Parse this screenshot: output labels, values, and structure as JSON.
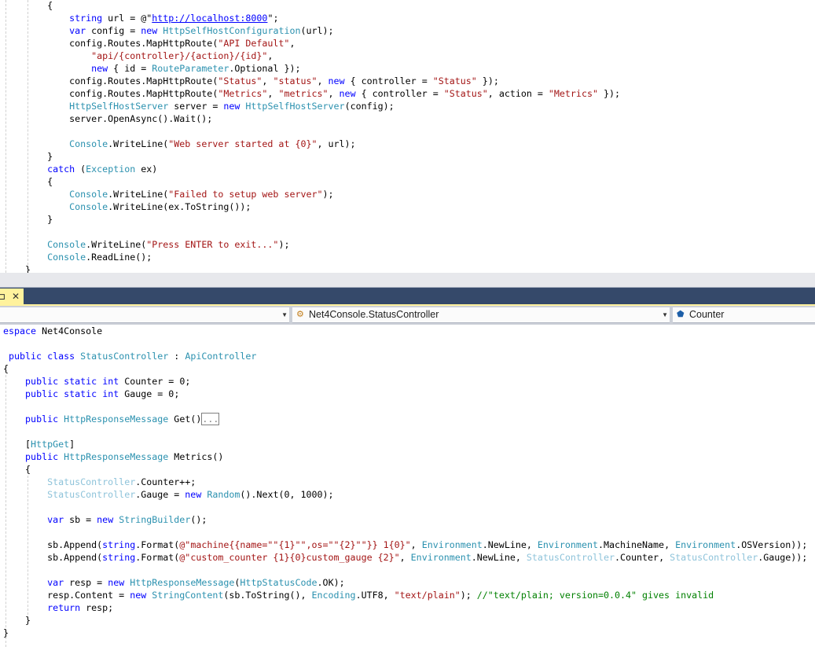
{
  "colors": {
    "keyword": "#0000ff",
    "type": "#2b91af",
    "string": "#a31515",
    "comment": "#008000",
    "titlebar": "#35496a",
    "tab": "#fff29d"
  },
  "tab": {
    "pin_icon": "⊐",
    "close_icon": "✕"
  },
  "navbar": {
    "project_dropdown": {
      "label": ""
    },
    "class_dropdown": {
      "label": "Net4Console.StatusController",
      "icon": "class-icon"
    },
    "member_dropdown": {
      "label": "Counter",
      "icon": "field-icon"
    }
  },
  "top_code": {
    "lines": [
      [
        [
          "p",
          "        {"
        ]
      ],
      [
        [
          "p",
          "            "
        ],
        [
          "k",
          "string"
        ],
        [
          "p",
          " url = @\""
        ],
        [
          "u",
          "http://localhost:8000"
        ],
        [
          "p",
          "\";"
        ]
      ],
      [
        [
          "p",
          "            "
        ],
        [
          "k",
          "var"
        ],
        [
          "p",
          " config = "
        ],
        [
          "k",
          "new"
        ],
        [
          "p",
          " "
        ],
        [
          "t",
          "HttpSelfHostConfiguration"
        ],
        [
          "p",
          "(url);"
        ]
      ],
      [
        [
          "p",
          "            config.Routes.MapHttpRoute("
        ],
        [
          "s",
          "\"API Default\""
        ],
        [
          "p",
          ","
        ]
      ],
      [
        [
          "p",
          "                "
        ],
        [
          "s",
          "\"api/{controller}/{action}/{id}\""
        ],
        [
          "p",
          ","
        ]
      ],
      [
        [
          "p",
          "                "
        ],
        [
          "k",
          "new"
        ],
        [
          "p",
          " { id = "
        ],
        [
          "t",
          "RouteParameter"
        ],
        [
          "p",
          ".Optional });"
        ]
      ],
      [
        [
          "p",
          "            config.Routes.MapHttpRoute("
        ],
        [
          "s",
          "\"Status\""
        ],
        [
          "p",
          ", "
        ],
        [
          "s",
          "\"status\""
        ],
        [
          "p",
          ", "
        ],
        [
          "k",
          "new"
        ],
        [
          "p",
          " { controller = "
        ],
        [
          "s",
          "\"Status\""
        ],
        [
          "p",
          " });"
        ]
      ],
      [
        [
          "p",
          "            config.Routes.MapHttpRoute("
        ],
        [
          "s",
          "\"Metrics\""
        ],
        [
          "p",
          ", "
        ],
        [
          "s",
          "\"metrics\""
        ],
        [
          "p",
          ", "
        ],
        [
          "k",
          "new"
        ],
        [
          "p",
          " { controller = "
        ],
        [
          "s",
          "\"Status\""
        ],
        [
          "p",
          ", action = "
        ],
        [
          "s",
          "\"Metrics\""
        ],
        [
          "p",
          " });"
        ]
      ],
      [
        [
          "p",
          "            "
        ],
        [
          "t",
          "HttpSelfHostServer"
        ],
        [
          "p",
          " server = "
        ],
        [
          "k",
          "new"
        ],
        [
          "p",
          " "
        ],
        [
          "t",
          "HttpSelfHostServer"
        ],
        [
          "p",
          "(config);"
        ]
      ],
      [
        [
          "p",
          "            server.OpenAsync().Wait();"
        ]
      ],
      [
        [
          "p",
          ""
        ]
      ],
      [
        [
          "p",
          "            "
        ],
        [
          "t",
          "Console"
        ],
        [
          "p",
          ".WriteLine("
        ],
        [
          "s",
          "\"Web server started at {0}\""
        ],
        [
          "p",
          ", url);"
        ]
      ],
      [
        [
          "p",
          "        }"
        ]
      ],
      [
        [
          "p",
          "        "
        ],
        [
          "k",
          "catch"
        ],
        [
          "p",
          " ("
        ],
        [
          "t",
          "Exception"
        ],
        [
          "p",
          " ex)"
        ]
      ],
      [
        [
          "p",
          "        {"
        ]
      ],
      [
        [
          "p",
          "            "
        ],
        [
          "t",
          "Console"
        ],
        [
          "p",
          ".WriteLine("
        ],
        [
          "s",
          "\"Failed to setup web server\""
        ],
        [
          "p",
          ");"
        ]
      ],
      [
        [
          "p",
          "            "
        ],
        [
          "t",
          "Console"
        ],
        [
          "p",
          ".WriteLine(ex.ToString());"
        ]
      ],
      [
        [
          "p",
          "        }"
        ]
      ],
      [
        [
          "p",
          ""
        ]
      ],
      [
        [
          "p",
          "        "
        ],
        [
          "t",
          "Console"
        ],
        [
          "p",
          ".WriteLine("
        ],
        [
          "s",
          "\"Press ENTER to exit...\""
        ],
        [
          "p",
          ");"
        ]
      ],
      [
        [
          "p",
          "        "
        ],
        [
          "t",
          "Console"
        ],
        [
          "p",
          ".ReadLine();"
        ]
      ],
      [
        [
          "p",
          "    }"
        ]
      ]
    ]
  },
  "bottom_code": {
    "lines": [
      [
        [
          "k",
          "espace"
        ],
        [
          "p",
          " Net4Console"
        ]
      ],
      [
        [
          "p",
          ""
        ]
      ],
      [
        [
          "p",
          " "
        ],
        [
          "k",
          "public"
        ],
        [
          "p",
          " "
        ],
        [
          "k",
          "class"
        ],
        [
          "p",
          " "
        ],
        [
          "t",
          "StatusController"
        ],
        [
          "p",
          " : "
        ],
        [
          "t",
          "ApiController"
        ]
      ],
      [
        [
          "p",
          "{"
        ]
      ],
      [
        [
          "p",
          "    "
        ],
        [
          "k",
          "public"
        ],
        [
          "p",
          " "
        ],
        [
          "k",
          "static"
        ],
        [
          "p",
          " "
        ],
        [
          "k",
          "int"
        ],
        [
          "p",
          " Counter = 0;"
        ]
      ],
      [
        [
          "p",
          "    "
        ],
        [
          "k",
          "public"
        ],
        [
          "p",
          " "
        ],
        [
          "k",
          "static"
        ],
        [
          "p",
          " "
        ],
        [
          "k",
          "int"
        ],
        [
          "p",
          " Gauge = 0;"
        ]
      ],
      [
        [
          "p",
          ""
        ]
      ],
      [
        [
          "p",
          "    "
        ],
        [
          "k",
          "public"
        ],
        [
          "p",
          " "
        ],
        [
          "t",
          "HttpResponseMessage"
        ],
        [
          "p",
          " Get()"
        ],
        [
          "box",
          "..."
        ]
      ],
      [
        [
          "p",
          ""
        ]
      ],
      [
        [
          "p",
          "    ["
        ],
        [
          "t",
          "HttpGet"
        ],
        [
          "p",
          "]"
        ]
      ],
      [
        [
          "p",
          "    "
        ],
        [
          "k",
          "public"
        ],
        [
          "p",
          " "
        ],
        [
          "t",
          "HttpResponseMessage"
        ],
        [
          "p",
          " Metrics()"
        ]
      ],
      [
        [
          "p",
          "    {"
        ]
      ],
      [
        [
          "p",
          "        "
        ],
        [
          "f",
          "StatusController"
        ],
        [
          "p",
          ".Counter++;"
        ]
      ],
      [
        [
          "p",
          "        "
        ],
        [
          "f",
          "StatusController"
        ],
        [
          "p",
          ".Gauge = "
        ],
        [
          "k",
          "new"
        ],
        [
          "p",
          " "
        ],
        [
          "t",
          "Random"
        ],
        [
          "p",
          "().Next(0, 1000);"
        ]
      ],
      [
        [
          "p",
          ""
        ]
      ],
      [
        [
          "p",
          "        "
        ],
        [
          "k",
          "var"
        ],
        [
          "p",
          " sb = "
        ],
        [
          "k",
          "new"
        ],
        [
          "p",
          " "
        ],
        [
          "t",
          "StringBuilder"
        ],
        [
          "p",
          "();"
        ]
      ],
      [
        [
          "p",
          ""
        ]
      ],
      [
        [
          "p",
          "        sb.Append("
        ],
        [
          "k",
          "string"
        ],
        [
          "p",
          ".Format("
        ],
        [
          "s",
          "@\"machine{{name=\"\"{1}\"\",os=\"\"{2}\"\"}} 1{0}\""
        ],
        [
          "p",
          ", "
        ],
        [
          "t",
          "Environment"
        ],
        [
          "p",
          ".NewLine, "
        ],
        [
          "t",
          "Environment"
        ],
        [
          "p",
          ".MachineName, "
        ],
        [
          "t",
          "Environment"
        ],
        [
          "p",
          ".OSVersion));"
        ]
      ],
      [
        [
          "p",
          "        sb.Append("
        ],
        [
          "k",
          "string"
        ],
        [
          "p",
          ".Format("
        ],
        [
          "s",
          "@\"custom_counter {1}{0}custom_gauge {2}\""
        ],
        [
          "p",
          ", "
        ],
        [
          "t",
          "Environment"
        ],
        [
          "p",
          ".NewLine, "
        ],
        [
          "f",
          "StatusController"
        ],
        [
          "p",
          ".Counter, "
        ],
        [
          "f",
          "StatusController"
        ],
        [
          "p",
          ".Gauge));"
        ]
      ],
      [
        [
          "p",
          ""
        ]
      ],
      [
        [
          "p",
          "        "
        ],
        [
          "k",
          "var"
        ],
        [
          "p",
          " resp = "
        ],
        [
          "k",
          "new"
        ],
        [
          "p",
          " "
        ],
        [
          "t",
          "HttpResponseMessage"
        ],
        [
          "p",
          "("
        ],
        [
          "t",
          "HttpStatusCode"
        ],
        [
          "p",
          ".OK);"
        ]
      ],
      [
        [
          "p",
          "        resp.Content = "
        ],
        [
          "k",
          "new"
        ],
        [
          "p",
          " "
        ],
        [
          "t",
          "StringContent"
        ],
        [
          "p",
          "(sb.ToString(), "
        ],
        [
          "t",
          "Encoding"
        ],
        [
          "p",
          ".UTF8, "
        ],
        [
          "s",
          "\"text/plain\""
        ],
        [
          "p",
          "); "
        ],
        [
          "c",
          "//\"text/plain; version=0.0.4\" gives invalid"
        ]
      ],
      [
        [
          "p",
          "        "
        ],
        [
          "k",
          "return"
        ],
        [
          "p",
          " resp;"
        ]
      ],
      [
        [
          "p",
          "    }"
        ]
      ],
      [
        [
          "p",
          "}"
        ]
      ]
    ]
  }
}
